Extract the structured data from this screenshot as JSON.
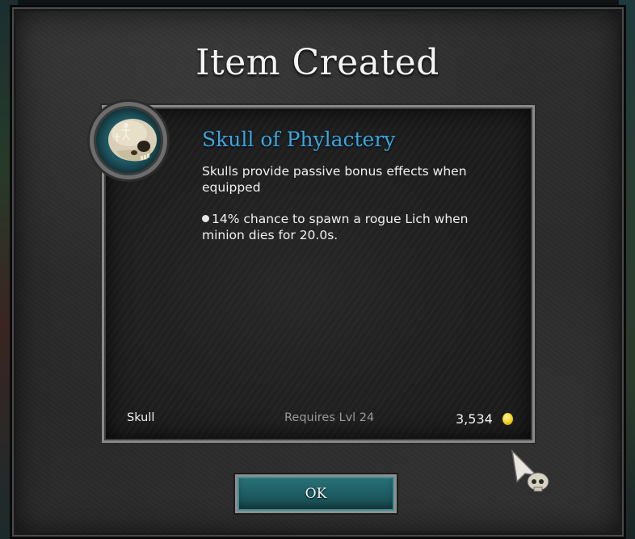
{
  "dialog": {
    "title": "Item Created"
  },
  "item": {
    "icon": "skull-icon",
    "name": "Skull of Phylactery",
    "description": "Skulls provide passive bonus effects when equipped",
    "effect": "14% chance to spawn a rogue Lich when minion dies for 20.0s.",
    "type": "Skull",
    "requirement": "Requires Lvl 24",
    "price": "3,534",
    "currency_icon": "gold-coin-icon"
  },
  "button": {
    "ok_label": "OK"
  },
  "colors": {
    "item_name": "#3aa6e0",
    "button_teal": "#1f5f66",
    "coin": "#f2d21c"
  }
}
